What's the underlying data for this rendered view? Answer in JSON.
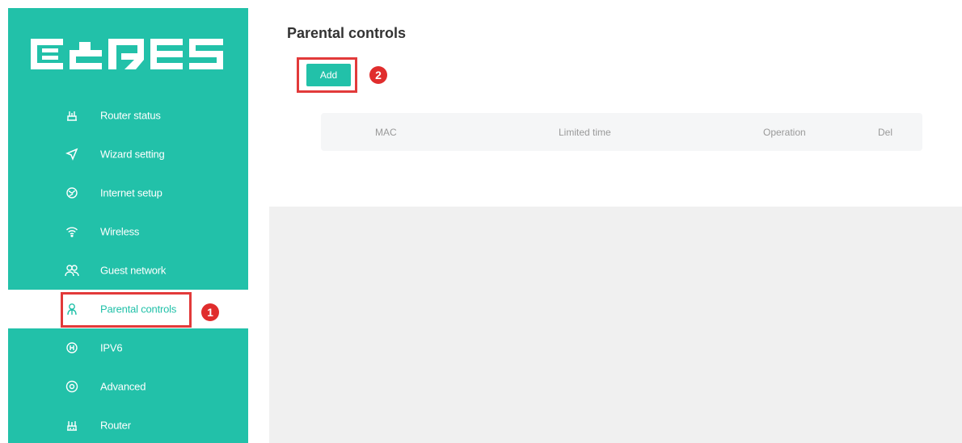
{
  "sidebar": {
    "logo_text": "CARES",
    "items": [
      {
        "label": "Router status",
        "icon": "router-status-icon"
      },
      {
        "label": "Wizard setting",
        "icon": "send-arrow-icon"
      },
      {
        "label": "Internet setup",
        "icon": "globe-icon"
      },
      {
        "label": "Wireless",
        "icon": "wifi-icon"
      },
      {
        "label": "Guest network",
        "icon": "guests-icon"
      },
      {
        "label": "Parental controls",
        "icon": "person-icon"
      },
      {
        "label": "IPV6",
        "icon": "ipv6-icon"
      },
      {
        "label": "Advanced",
        "icon": "settings-ring-icon"
      },
      {
        "label": "Router",
        "icon": "router-icon"
      }
    ],
    "active_index": 5
  },
  "main": {
    "title": "Parental controls",
    "add_label": "Add",
    "table": {
      "headers": [
        "MAC",
        "Limited time",
        "Operation",
        "Del"
      ]
    }
  },
  "annotations": {
    "step1": "1",
    "step2": "2"
  },
  "colors": {
    "accent": "#22c1a9",
    "annotation": "#e02d2d"
  }
}
